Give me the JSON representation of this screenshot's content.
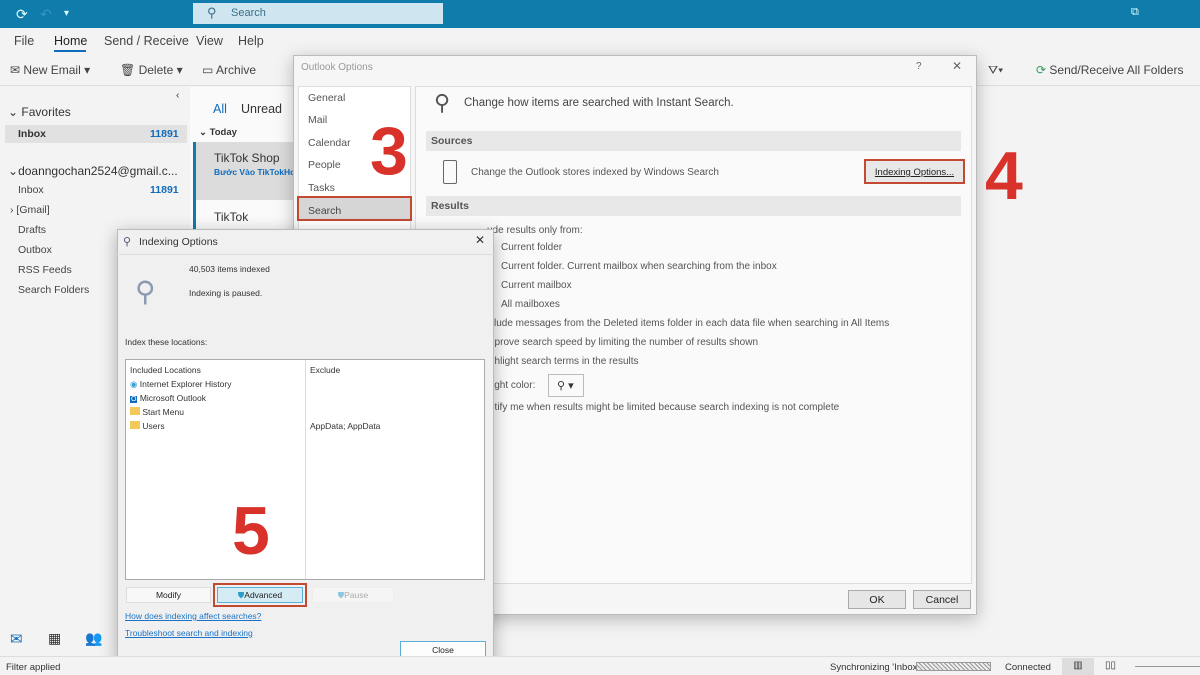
{
  "titlebar": {
    "search_placeholder": "Search",
    "icons": [
      "sync-icon",
      "undo-icon",
      "customize-icon",
      "restore-icon"
    ]
  },
  "menu": [
    "File",
    "Home",
    "Send / Receive",
    "View",
    "Help"
  ],
  "toolbar": {
    "new_email": "New Email",
    "delete": "Delete",
    "archive": "Archive",
    "send_receive_all": "Send/Receive All Folders"
  },
  "nav": {
    "favorites": "Favorites",
    "fav_inbox": "Inbox",
    "fav_inbox_count": "11891",
    "account": "doanngochan2524@gmail.c...",
    "folders": [
      {
        "label": "Inbox",
        "count": "11891"
      },
      {
        "label": "[Gmail]"
      },
      {
        "label": "Drafts"
      },
      {
        "label": "Outbox"
      },
      {
        "label": "RSS Feeds"
      },
      {
        "label": "Search Folders"
      }
    ]
  },
  "messages": {
    "tab_all": "All",
    "tab_unread": "Unread",
    "group": "Today",
    "items": [
      {
        "sender": "TikTok Shop",
        "subject": "Bước Vào TikTokHo"
      },
      {
        "sender": "TikTok",
        "subject": ""
      }
    ]
  },
  "options": {
    "title": "Outlook Options",
    "help": "?",
    "nav": [
      "General",
      "Mail",
      "Calendar",
      "People",
      "Tasks",
      "Search"
    ],
    "header": "Change how items are searched with Instant Search.",
    "sources": "Sources",
    "sources_text": "Change the Outlook stores indexed by Windows Search",
    "indexing_button": "Indexing Options...",
    "results": "Results",
    "result_lines": [
      "Include results only from:",
      "Current folder",
      "Current folder. Current mailbox when searching from the inbox",
      "Current mailbox",
      "All mailboxes",
      "Include messages from the Deleted items folder in each data file when searching in All Items",
      "Improve search speed by limiting the number of results shown",
      "Highlight search terms in the results",
      "Highlight color:",
      "Notify me when results might be limited because search indexing is not complete"
    ],
    "visible_lines": [
      "ude results only from:",
      "Current folder",
      "Current folder. Current mailbox when searching from the inbox",
      "Current mailbox",
      "All mailboxes",
      "clude messages from the Deleted items folder in each data file when searching in All Items",
      "nprove search speed by limiting the number of results shown",
      "ghlight search terms in the results",
      "ight color:",
      "otify me when results might be limited because search indexing is not complete"
    ],
    "ok": "OK",
    "cancel": "Cancel"
  },
  "indexing": {
    "title": "Indexing Options",
    "items_indexed": "40,503 items indexed",
    "status": "Indexing is paused.",
    "index_label": "Index these locations:",
    "col_included": "Included Locations",
    "col_exclude": "Exclude",
    "locations": [
      {
        "name": "Internet Explorer History",
        "exclude": ""
      },
      {
        "name": "Microsoft Outlook",
        "exclude": ""
      },
      {
        "name": "Start Menu",
        "exclude": ""
      },
      {
        "name": "Users",
        "exclude": "AppData; AppData"
      }
    ],
    "modify": "Modify",
    "advanced": "Advanced",
    "pause": "Pause",
    "link1": "How does indexing affect searches?",
    "link2": "Troubleshoot search and indexing",
    "close": "Close"
  },
  "annotations": {
    "step3": "3",
    "step4": "4",
    "step5": "5",
    "color": "#d9322b"
  },
  "status": {
    "left": "Filter applied",
    "sync": "Synchronizing  'Inbox'",
    "connected": "Connected"
  }
}
